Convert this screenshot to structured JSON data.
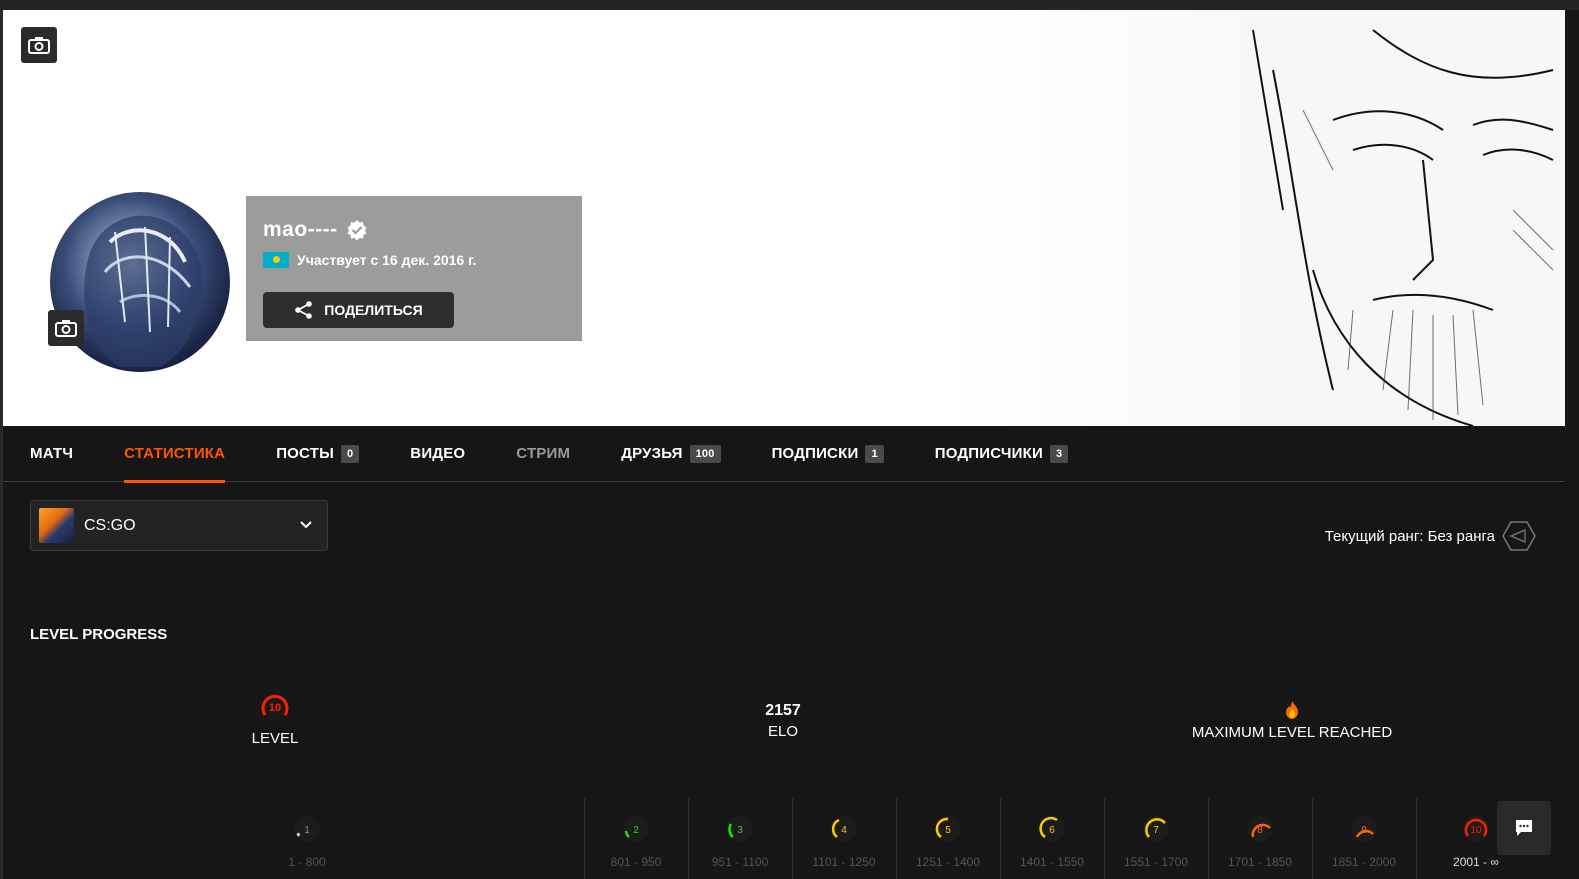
{
  "profile": {
    "nickname": "mao----",
    "member_since": "Участвует с 16 дек. 2016 г.",
    "share_label": "ПОДЕЛИТЬСЯ"
  },
  "tabs": [
    {
      "label": "МАТЧ",
      "badge": null
    },
    {
      "label": "СТАТИСТИКА",
      "badge": null
    },
    {
      "label": "ПОСТЫ",
      "badge": "0"
    },
    {
      "label": "ВИДЕО",
      "badge": null
    },
    {
      "label": "СТРИМ",
      "badge": null
    },
    {
      "label": "ДРУЗЬЯ",
      "badge": "100"
    },
    {
      "label": "ПОДПИСКИ",
      "badge": "1"
    },
    {
      "label": "ПОДПИСЧИКИ",
      "badge": "3"
    }
  ],
  "game_select": {
    "value": "CS:GO"
  },
  "rank_text": "Текущий ранг: Без ранга",
  "level_progress": {
    "title": "LEVEL PROGRESS",
    "level_value": "10",
    "level_label": "LEVEL",
    "elo_value": "2157",
    "elo_label": "ELO",
    "max_label": "MAXIMUM LEVEL REACHED"
  },
  "levels": [
    {
      "level": "1",
      "range": "1 - 800",
      "color": "#555555"
    },
    {
      "level": "2",
      "range": "801 - 950",
      "color": "#1ce400"
    },
    {
      "level": "3",
      "range": "951 - 1100",
      "color": "#1ce400"
    },
    {
      "level": "4",
      "range": "1101 - 1250",
      "color": "#ffc800"
    },
    {
      "level": "5",
      "range": "1251 - 1400",
      "color": "#ffc800"
    },
    {
      "level": "6",
      "range": "1401 - 1550",
      "color": "#ffc800"
    },
    {
      "level": "7",
      "range": "1551 - 1700",
      "color": "#ffc800"
    },
    {
      "level": "8",
      "range": "1701 - 1850",
      "color": "#ff6309"
    },
    {
      "level": "9",
      "range": "1851 - 2000",
      "color": "#ff6309"
    },
    {
      "level": "10",
      "range": "2001 - ∞",
      "color": "#fe1f00"
    }
  ],
  "colors": {
    "accent": "#ff5500",
    "level10": "#fe1f00"
  }
}
